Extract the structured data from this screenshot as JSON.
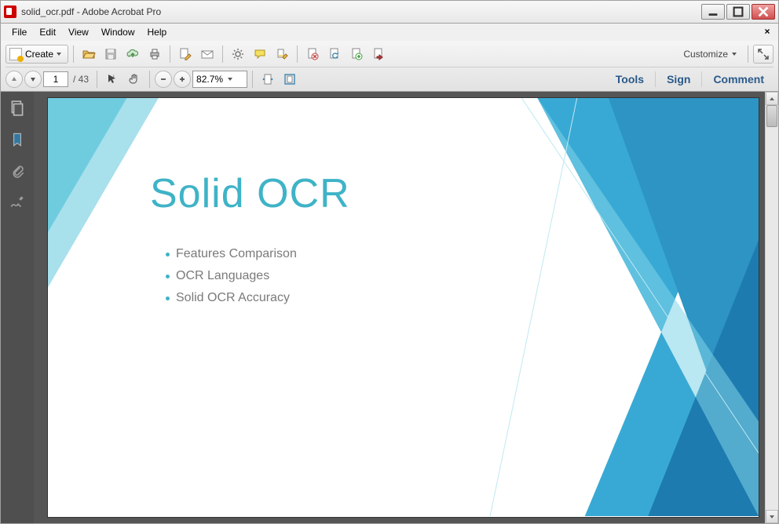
{
  "window": {
    "title": "solid_ocr.pdf - Adobe Acrobat Pro"
  },
  "menu": {
    "items": [
      "File",
      "Edit",
      "View",
      "Window",
      "Help"
    ]
  },
  "toolbar": {
    "create_label": "Create",
    "customize_label": "Customize"
  },
  "nav": {
    "current_page": "1",
    "total_pages": "/ 43",
    "zoom": "82.7%"
  },
  "panels": {
    "tools": "Tools",
    "sign": "Sign",
    "comment": "Comment"
  },
  "slide": {
    "title": "Solid OCR",
    "bullets": [
      "Features Comparison",
      "OCR Languages",
      "Solid OCR Accuracy"
    ]
  }
}
